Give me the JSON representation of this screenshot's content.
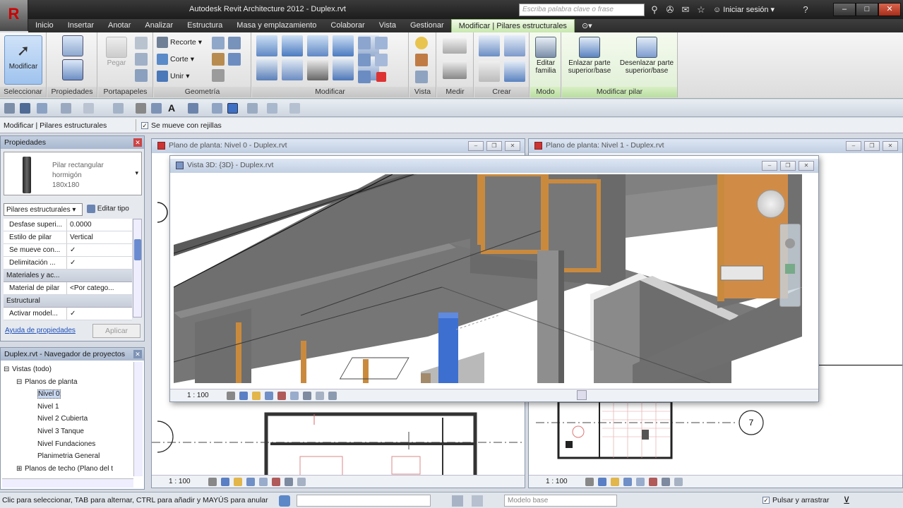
{
  "app": {
    "title": "Autodesk Revit Architecture 2012 -    Duplex.rvt",
    "search_placeholder": "Escriba palabra clave o frase",
    "signin_label": "Iniciar sesión",
    "logo_letter": "R"
  },
  "ribbon_tabs": [
    "Inicio",
    "Insertar",
    "Anotar",
    "Analizar",
    "Estructura",
    "Masa y emplazamiento",
    "Colaborar",
    "Vista",
    "Gestionar",
    "Modificar | Pilares estructurales"
  ],
  "ribbon": {
    "select": {
      "button": "Modificar",
      "label": "Seleccionar"
    },
    "properties": {
      "label": "Propiedades"
    },
    "clipboard": {
      "button": "Pegar",
      "label": "Portapapeles"
    },
    "geometry": {
      "cut_label": "Recorte",
      "cope_label": "Corte",
      "join_label": "Unir",
      "label": "Geometría"
    },
    "modify": {
      "label": "Modificar"
    },
    "view": {
      "label": "Vista"
    },
    "measure": {
      "label": "Medir"
    },
    "create": {
      "label": "Crear"
    },
    "mode": {
      "button_line1": "Editar",
      "button_line2": "familia",
      "label": "Modo"
    },
    "modify_column": {
      "attach_line1": "Enlazar parte",
      "attach_line2": "superior/base",
      "detach_line1": "Desenlazar parte",
      "detach_line2": "superior/base",
      "label": "Modificar pilar"
    }
  },
  "options_bar": {
    "context": "Modificar | Pilares estructurales",
    "moves_with_grids": "Se mueve con rejillas"
  },
  "properties": {
    "title": "Propiedades",
    "type_name": [
      "Pilar rectangular",
      "hormigón",
      "180x180"
    ],
    "category": "Pilares estructurales",
    "edit_type": "Editar tipo",
    "rows": [
      {
        "kind": "row",
        "name": "Desfase superi...",
        "value": "0.0000"
      },
      {
        "kind": "row",
        "name": "Estilo de pilar",
        "value": "Vertical"
      },
      {
        "kind": "row",
        "name": "Se mueve con...",
        "value": "✓"
      },
      {
        "kind": "row",
        "name": "Delimitación ...",
        "value": "✓"
      },
      {
        "kind": "group",
        "name": "Materiales y ac..."
      },
      {
        "kind": "row",
        "name": "Material de pilar",
        "value": "<Por catego..."
      },
      {
        "kind": "group",
        "name": "Estructural"
      },
      {
        "kind": "row",
        "name": "Activar model...",
        "value": "✓"
      }
    ],
    "help_link": "Ayuda de propiedades",
    "apply": "Aplicar"
  },
  "browser": {
    "title": "Duplex.rvt - Navegador de proyectos",
    "items": [
      {
        "text": "Vistas (todo)",
        "level": 0,
        "toggle": "⊟"
      },
      {
        "text": "Planos de planta",
        "level": 1,
        "toggle": "⊟"
      },
      {
        "text": "Nivel 0",
        "level": 2,
        "toggle": "",
        "selected": true
      },
      {
        "text": "Nivel 1",
        "level": 2,
        "toggle": ""
      },
      {
        "text": "Nivel 2 Cubierta",
        "level": 2,
        "toggle": ""
      },
      {
        "text": "Nivel 3 Tanque",
        "level": 2,
        "toggle": ""
      },
      {
        "text": "Nivel Fundaciones",
        "level": 2,
        "toggle": ""
      },
      {
        "text": "Planimetria General",
        "level": 2,
        "toggle": ""
      },
      {
        "text": "Planos de techo (Plano del t",
        "level": 1,
        "toggle": "⊞"
      }
    ]
  },
  "views": {
    "plan0": {
      "title": "Plano de planta: Nivel 0 - Duplex.rvt",
      "scale": "1 : 100"
    },
    "plan1": {
      "title": "Plano de planta: Nivel 1 - Duplex.rvt",
      "scale": "1 : 100",
      "grid_bubble": "7"
    },
    "view3d": {
      "title": "Vista 3D: {3D} - Duplex.rvt",
      "scale": "1 : 100"
    }
  },
  "status": {
    "text": "Clic para seleccionar, TAB para alternar, CTRL para añadir y MAYÚS para anular",
    "model": "Modelo base",
    "press_drag": "Pulsar y arrastrar"
  },
  "colors": {
    "selected_column": "#3d6fd1",
    "wood_frame": "#c98a3e",
    "wall_gray": "#6e6e6e",
    "ribbon_active_tab": "#c7e7ae"
  }
}
